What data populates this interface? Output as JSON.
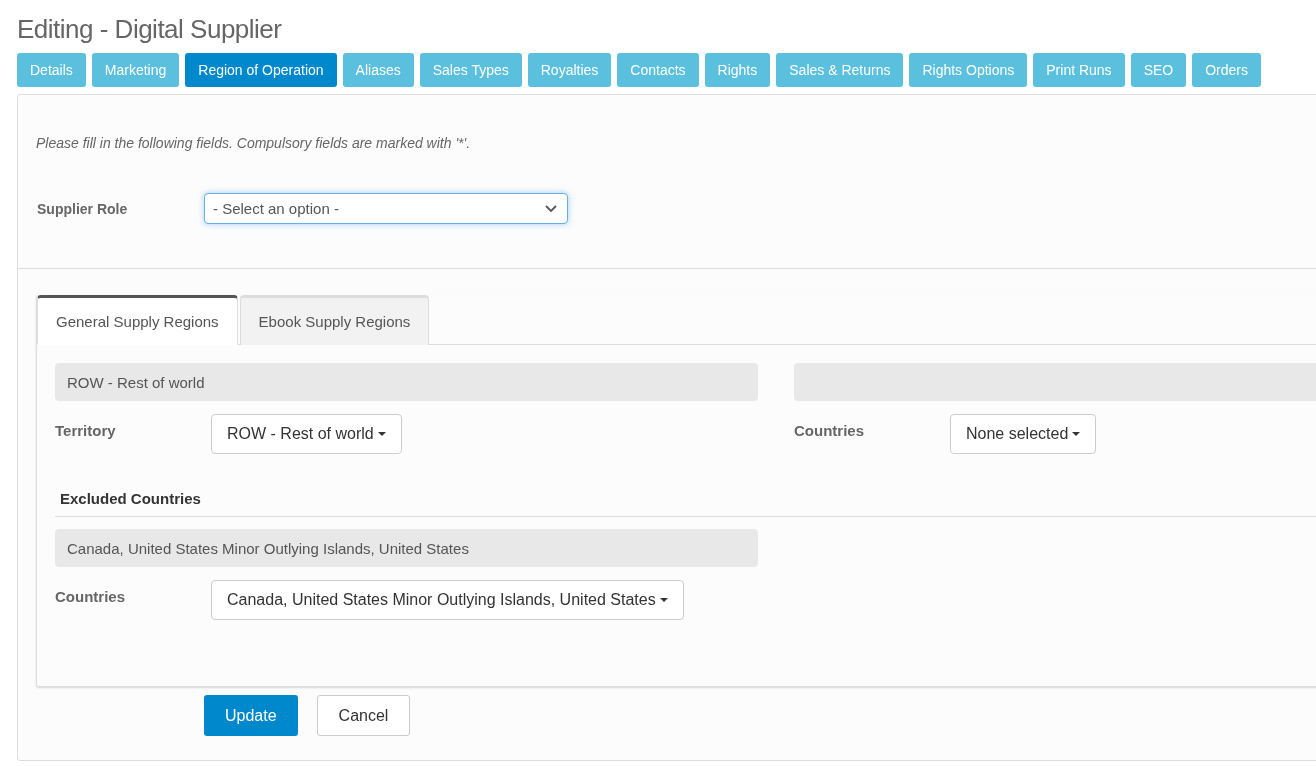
{
  "page_title": "Editing - Digital Supplier",
  "tabs": [
    {
      "label": "Details",
      "selected": false
    },
    {
      "label": "Marketing",
      "selected": false
    },
    {
      "label": "Region of Operation",
      "selected": true
    },
    {
      "label": "Aliases",
      "selected": false
    },
    {
      "label": "Sales Types",
      "selected": false
    },
    {
      "label": "Royalties",
      "selected": false
    },
    {
      "label": "Contacts",
      "selected": false
    },
    {
      "label": "Rights",
      "selected": false
    },
    {
      "label": "Sales & Returns",
      "selected": false
    },
    {
      "label": "Rights Options",
      "selected": false
    },
    {
      "label": "Print Runs",
      "selected": false
    },
    {
      "label": "SEO",
      "selected": false
    },
    {
      "label": "Orders",
      "selected": false
    }
  ],
  "instructions": "Please fill in the following fields. Compulsory fields are marked with '*'.",
  "supplier_role": {
    "label": "Supplier Role",
    "placeholder": "- Select an option -"
  },
  "region_tabs": [
    {
      "label": "General Supply Regions",
      "selected": true
    },
    {
      "label": "Ebook Supply Regions",
      "selected": false
    }
  ],
  "territory": {
    "summary": "ROW - Rest of world",
    "label": "Territory",
    "value": "ROW - Rest of world"
  },
  "countries": {
    "label": "Countries",
    "value": "None selected"
  },
  "excluded": {
    "heading": "Excluded Countries",
    "summary": "Canada, United States Minor Outlying Islands, United States",
    "label": "Countries",
    "value": "Canada, United States Minor Outlying Islands, United States"
  },
  "buttons": {
    "primary": "Update",
    "secondary": "Cancel"
  }
}
